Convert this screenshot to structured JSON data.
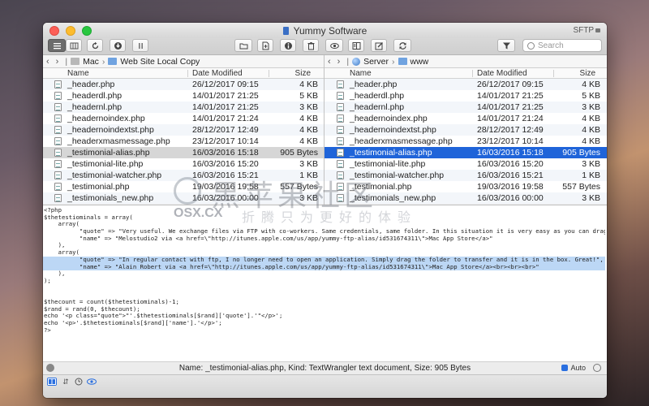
{
  "window": {
    "title": "Yummy Software",
    "protocol": "SFTP"
  },
  "toolbar": {
    "search_placeholder": "Search"
  },
  "left_pane": {
    "path": [
      "Mac",
      "Web Site Local Copy"
    ],
    "columns": {
      "name": "Name",
      "date": "Date Modified",
      "size": "Size"
    },
    "files": [
      {
        "name": "_header.php",
        "date": "26/12/2017 09:15",
        "size": "4 KB"
      },
      {
        "name": "_headerdl.php",
        "date": "14/01/2017 21:25",
        "size": "5 KB"
      },
      {
        "name": "_headernl.php",
        "date": "14/01/2017 21:25",
        "size": "3 KB"
      },
      {
        "name": "_headernoindex.php",
        "date": "14/01/2017 21:24",
        "size": "4 KB"
      },
      {
        "name": "_headernoindextst.php",
        "date": "28/12/2017 12:49",
        "size": "4 KB"
      },
      {
        "name": "_headerxmasmessage.php",
        "date": "23/12/2017 10:14",
        "size": "4 KB"
      },
      {
        "name": "_testimonial-alias.php",
        "date": "16/03/2016 15:18",
        "size": "905 Bytes"
      },
      {
        "name": "_testimonial-lite.php",
        "date": "16/03/2016 15:20",
        "size": "3 KB"
      },
      {
        "name": "_testimonial-watcher.php",
        "date": "16/03/2016 15:21",
        "size": "1 KB"
      },
      {
        "name": "_testimonial.php",
        "date": "19/03/2016 19:58",
        "size": "557 Bytes"
      },
      {
        "name": "_testimonials_new.php",
        "date": "16/03/2016 00:00",
        "size": "3 KB"
      }
    ],
    "selected_index": 6
  },
  "right_pane": {
    "path": [
      "Server",
      "www"
    ],
    "columns": {
      "name": "Name",
      "date": "Date Modified",
      "size": "Size"
    },
    "files": [
      {
        "name": "_header.php",
        "date": "26/12/2017 09:15",
        "size": "4 KB"
      },
      {
        "name": "_headerdl.php",
        "date": "14/01/2017 21:25",
        "size": "5 KB"
      },
      {
        "name": "_headernl.php",
        "date": "14/01/2017 21:25",
        "size": "3 KB"
      },
      {
        "name": "_headernoindex.php",
        "date": "14/01/2017 21:24",
        "size": "4 KB"
      },
      {
        "name": "_headernoindextst.php",
        "date": "28/12/2017 12:49",
        "size": "4 KB"
      },
      {
        "name": "_headerxmasmessage.php",
        "date": "23/12/2017 10:14",
        "size": "4 KB"
      },
      {
        "name": "_testimonial-alias.php",
        "date": "16/03/2016 15:18",
        "size": "905 Bytes"
      },
      {
        "name": "_testimonial-lite.php",
        "date": "16/03/2016 15:20",
        "size": "3 KB"
      },
      {
        "name": "_testimonial-watcher.php",
        "date": "16/03/2016 15:21",
        "size": "1 KB"
      },
      {
        "name": "_testimonial.php",
        "date": "19/03/2016 19:58",
        "size": "557 Bytes"
      },
      {
        "name": "_testimonials_new.php",
        "date": "16/03/2016 00:00",
        "size": "3 KB"
      }
    ],
    "selected_index": 6
  },
  "editor": {
    "lines": [
      "<?php",
      "$thetestiominals = array(",
      "    array(",
      "          \"quote\" => \"Very useful. We exchange files via FTP with co-workers. Same credentials, same folder. In this situation it is very easy as you can drag & drop files\",",
      "          \"name\" => \"Melostudio2 via <a href=\\\"http://itunes.apple.com/us/app/yummy-ftp-alias/id531674311\\\">Mac App Store</a>\"",
      "    ),",
      "    array(",
      "          \"quote\" => \"In regular contact with ftp, I no longer need to open an application. Simply drag the folder to transfer and it is in the box. Great!\",",
      "          \"name\" => \"Alain Robert via <a href=\\\"http://itunes.apple.com/us/app/yummy-ftp-alias/id531674311\\\">Mac App Store</a><br><br><br>\"",
      "    ),",
      ");",
      "",
      "",
      "$thecount = count($thetestiominals)-1;",
      "$rand = rand(0, $thecount);",
      "echo '<p class=\"quote\">\"'.$thetestiominals[$rand]['quote'].'\"</p>';",
      "echo '<p>'.$thetestiominals[$rand]['name'].'</p>';",
      "?>"
    ],
    "highlighted_lines": [
      7,
      8
    ]
  },
  "status": {
    "info": "Name: _testimonial-alias.php,  Kind: TextWrangler text document,  Size: 905 Bytes",
    "auto_label": "Auto"
  },
  "watermark": {
    "cn": "黑苹果社区",
    "osx": "OSX.CX",
    "tag": "折腾只为更好的体验"
  },
  "colors": {
    "selection_blue": "#1f64d9",
    "code_highlight": "#bcd7f5"
  }
}
